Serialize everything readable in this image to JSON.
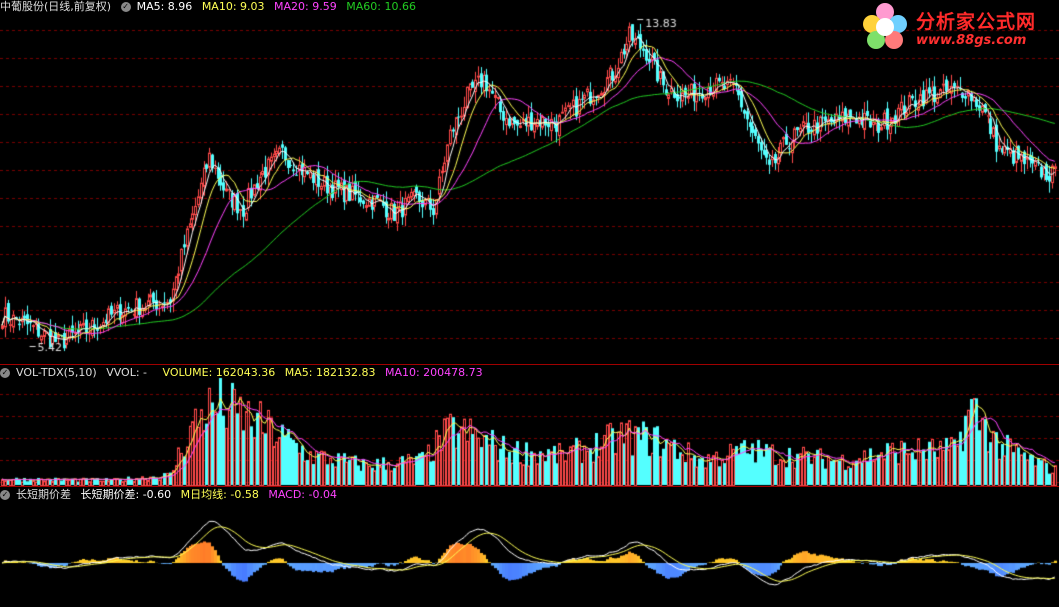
{
  "price_panel": {
    "stock_name": "中葡股份",
    "period": "(日线,前复权)",
    "ma5_label": "MA5: 8.96",
    "ma10_label": "MA10: 9.03",
    "ma20_label": "MA20: 9.59",
    "ma60_label": "MA60: 10.66",
    "high_marker": "13.83",
    "low_marker": "5.42"
  },
  "volume_panel": {
    "indicator": "VOL-TDX(5,10)",
    "vvol_label": "VVOL: -",
    "volume_label": "VOLUME: 162043.36",
    "ma5_label": "MA5: 182132.83",
    "ma10_label": "MA10: 200478.73"
  },
  "macd_panel": {
    "indicator": "长短期价差",
    "diff_label": "长短期价差: -0.60",
    "dea_label": "M日均线: -0.58",
    "macd_label": "MACD: -0.04"
  },
  "logo": {
    "title": "分析家公式网",
    "url": "www.88gs.com"
  },
  "colors": {
    "up": "#ff4a4a",
    "down": "#54ffff",
    "ma5": "#ffffff",
    "ma10": "#ffff55",
    "ma20": "#ff44ff",
    "ma60": "#22cc22",
    "grid": "#7a0000",
    "border": "#a00000"
  },
  "chart_data": [
    {
      "type": "candlestick",
      "title": "中葡股份 (日线,前复权)",
      "ylim": [
        5.0,
        14.2
      ],
      "max_label": 13.83,
      "min_label": 5.42,
      "series": [
        {
          "name": "MA5",
          "last": 8.96
        },
        {
          "name": "MA10",
          "last": 9.03
        },
        {
          "name": "MA20",
          "last": 9.59
        },
        {
          "name": "MA60",
          "last": 10.66
        }
      ],
      "close_path": [
        [
          0,
          6.2
        ],
        [
          10,
          5.9
        ],
        [
          20,
          5.45
        ],
        [
          30,
          5.8
        ],
        [
          42,
          6.3
        ],
        [
          52,
          6.5
        ],
        [
          60,
          6.6
        ],
        [
          66,
          8.3
        ],
        [
          74,
          10.4
        ],
        [
          80,
          9.4
        ],
        [
          86,
          9.0
        ],
        [
          92,
          9.9
        ],
        [
          100,
          10.5
        ],
        [
          108,
          10.0
        ],
        [
          114,
          9.7
        ],
        [
          124,
          9.4
        ],
        [
          134,
          9.2
        ],
        [
          140,
          8.9
        ],
        [
          148,
          9.3
        ],
        [
          154,
          9.0
        ],
        [
          160,
          11.0
        ],
        [
          166,
          12.0
        ],
        [
          172,
          12.5
        ],
        [
          178,
          11.6
        ],
        [
          184,
          11.2
        ],
        [
          190,
          11.4
        ],
        [
          198,
          11.3
        ],
        [
          206,
          11.8
        ],
        [
          212,
          12.2
        ],
        [
          218,
          12.6
        ],
        [
          224,
          13.6
        ],
        [
          230,
          13.2
        ],
        [
          236,
          12.3
        ],
        [
          244,
          12.0
        ],
        [
          252,
          12.3
        ],
        [
          262,
          12.2
        ],
        [
          268,
          11.0
        ],
        [
          274,
          10.0
        ],
        [
          280,
          10.8
        ],
        [
          288,
          11.2
        ],
        [
          296,
          11.3
        ],
        [
          304,
          11.5
        ],
        [
          312,
          11.2
        ],
        [
          320,
          11.6
        ],
        [
          328,
          12.0
        ],
        [
          336,
          12.1
        ],
        [
          344,
          12.2
        ],
        [
          350,
          11.7
        ],
        [
          356,
          10.6
        ],
        [
          362,
          10.4
        ],
        [
          368,
          10.1
        ],
        [
          376,
          9.9
        ]
      ]
    },
    {
      "type": "bar",
      "title": "VOL-TDX(5,10)",
      "series": [
        {
          "name": "VOLUME",
          "last": 162043.36
        },
        {
          "name": "MA5",
          "last": 182132.83
        },
        {
          "name": "MA10",
          "last": 200478.73
        }
      ],
      "volume_path": [
        [
          0,
          0.06
        ],
        [
          40,
          0.05
        ],
        [
          60,
          0.1
        ],
        [
          66,
          0.5
        ],
        [
          72,
          0.75
        ],
        [
          78,
          0.8
        ],
        [
          86,
          0.7
        ],
        [
          96,
          0.55
        ],
        [
          110,
          0.3
        ],
        [
          130,
          0.2
        ],
        [
          150,
          0.25
        ],
        [
          160,
          0.55
        ],
        [
          168,
          0.5
        ],
        [
          180,
          0.35
        ],
        [
          200,
          0.3
        ],
        [
          212,
          0.4
        ],
        [
          222,
          0.5
        ],
        [
          234,
          0.45
        ],
        [
          250,
          0.25
        ],
        [
          266,
          0.35
        ],
        [
          280,
          0.3
        ],
        [
          300,
          0.25
        ],
        [
          320,
          0.35
        ],
        [
          340,
          0.35
        ],
        [
          346,
          0.78
        ],
        [
          356,
          0.4
        ],
        [
          376,
          0.15
        ]
      ]
    },
    {
      "type": "bar",
      "title": "长短期价差",
      "series": [
        {
          "name": "长短期价差",
          "last": -0.6
        },
        {
          "name": "M日均线",
          "last": -0.58
        },
        {
          "name": "MACD",
          "last": -0.04
        }
      ]
    }
  ]
}
